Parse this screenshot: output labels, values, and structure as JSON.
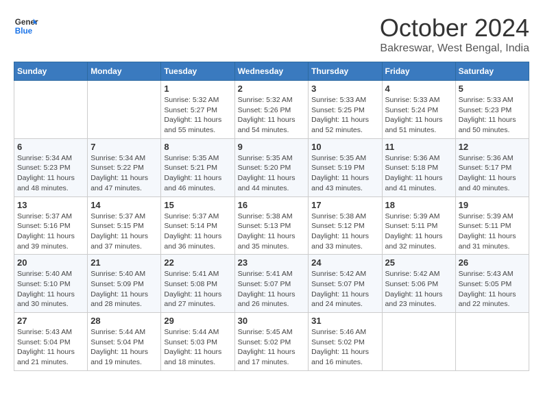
{
  "logo": {
    "line1": "General",
    "line2": "Blue"
  },
  "title": "October 2024",
  "location": "Bakreswar, West Bengal, India",
  "days_of_week": [
    "Sunday",
    "Monday",
    "Tuesday",
    "Wednesday",
    "Thursday",
    "Friday",
    "Saturday"
  ],
  "weeks": [
    [
      {
        "day": "",
        "sunrise": "",
        "sunset": "",
        "daylight": ""
      },
      {
        "day": "",
        "sunrise": "",
        "sunset": "",
        "daylight": ""
      },
      {
        "day": "1",
        "sunrise": "Sunrise: 5:32 AM",
        "sunset": "Sunset: 5:27 PM",
        "daylight": "Daylight: 11 hours and 55 minutes."
      },
      {
        "day": "2",
        "sunrise": "Sunrise: 5:32 AM",
        "sunset": "Sunset: 5:26 PM",
        "daylight": "Daylight: 11 hours and 54 minutes."
      },
      {
        "day": "3",
        "sunrise": "Sunrise: 5:33 AM",
        "sunset": "Sunset: 5:25 PM",
        "daylight": "Daylight: 11 hours and 52 minutes."
      },
      {
        "day": "4",
        "sunrise": "Sunrise: 5:33 AM",
        "sunset": "Sunset: 5:24 PM",
        "daylight": "Daylight: 11 hours and 51 minutes."
      },
      {
        "day": "5",
        "sunrise": "Sunrise: 5:33 AM",
        "sunset": "Sunset: 5:23 PM",
        "daylight": "Daylight: 11 hours and 50 minutes."
      }
    ],
    [
      {
        "day": "6",
        "sunrise": "Sunrise: 5:34 AM",
        "sunset": "Sunset: 5:23 PM",
        "daylight": "Daylight: 11 hours and 48 minutes."
      },
      {
        "day": "7",
        "sunrise": "Sunrise: 5:34 AM",
        "sunset": "Sunset: 5:22 PM",
        "daylight": "Daylight: 11 hours and 47 minutes."
      },
      {
        "day": "8",
        "sunrise": "Sunrise: 5:35 AM",
        "sunset": "Sunset: 5:21 PM",
        "daylight": "Daylight: 11 hours and 46 minutes."
      },
      {
        "day": "9",
        "sunrise": "Sunrise: 5:35 AM",
        "sunset": "Sunset: 5:20 PM",
        "daylight": "Daylight: 11 hours and 44 minutes."
      },
      {
        "day": "10",
        "sunrise": "Sunrise: 5:35 AM",
        "sunset": "Sunset: 5:19 PM",
        "daylight": "Daylight: 11 hours and 43 minutes."
      },
      {
        "day": "11",
        "sunrise": "Sunrise: 5:36 AM",
        "sunset": "Sunset: 5:18 PM",
        "daylight": "Daylight: 11 hours and 41 minutes."
      },
      {
        "day": "12",
        "sunrise": "Sunrise: 5:36 AM",
        "sunset": "Sunset: 5:17 PM",
        "daylight": "Daylight: 11 hours and 40 minutes."
      }
    ],
    [
      {
        "day": "13",
        "sunrise": "Sunrise: 5:37 AM",
        "sunset": "Sunset: 5:16 PM",
        "daylight": "Daylight: 11 hours and 39 minutes."
      },
      {
        "day": "14",
        "sunrise": "Sunrise: 5:37 AM",
        "sunset": "Sunset: 5:15 PM",
        "daylight": "Daylight: 11 hours and 37 minutes."
      },
      {
        "day": "15",
        "sunrise": "Sunrise: 5:37 AM",
        "sunset": "Sunset: 5:14 PM",
        "daylight": "Daylight: 11 hours and 36 minutes."
      },
      {
        "day": "16",
        "sunrise": "Sunrise: 5:38 AM",
        "sunset": "Sunset: 5:13 PM",
        "daylight": "Daylight: 11 hours and 35 minutes."
      },
      {
        "day": "17",
        "sunrise": "Sunrise: 5:38 AM",
        "sunset": "Sunset: 5:12 PM",
        "daylight": "Daylight: 11 hours and 33 minutes."
      },
      {
        "day": "18",
        "sunrise": "Sunrise: 5:39 AM",
        "sunset": "Sunset: 5:11 PM",
        "daylight": "Daylight: 11 hours and 32 minutes."
      },
      {
        "day": "19",
        "sunrise": "Sunrise: 5:39 AM",
        "sunset": "Sunset: 5:11 PM",
        "daylight": "Daylight: 11 hours and 31 minutes."
      }
    ],
    [
      {
        "day": "20",
        "sunrise": "Sunrise: 5:40 AM",
        "sunset": "Sunset: 5:10 PM",
        "daylight": "Daylight: 11 hours and 30 minutes."
      },
      {
        "day": "21",
        "sunrise": "Sunrise: 5:40 AM",
        "sunset": "Sunset: 5:09 PM",
        "daylight": "Daylight: 11 hours and 28 minutes."
      },
      {
        "day": "22",
        "sunrise": "Sunrise: 5:41 AM",
        "sunset": "Sunset: 5:08 PM",
        "daylight": "Daylight: 11 hours and 27 minutes."
      },
      {
        "day": "23",
        "sunrise": "Sunrise: 5:41 AM",
        "sunset": "Sunset: 5:07 PM",
        "daylight": "Daylight: 11 hours and 26 minutes."
      },
      {
        "day": "24",
        "sunrise": "Sunrise: 5:42 AM",
        "sunset": "Sunset: 5:07 PM",
        "daylight": "Daylight: 11 hours and 24 minutes."
      },
      {
        "day": "25",
        "sunrise": "Sunrise: 5:42 AM",
        "sunset": "Sunset: 5:06 PM",
        "daylight": "Daylight: 11 hours and 23 minutes."
      },
      {
        "day": "26",
        "sunrise": "Sunrise: 5:43 AM",
        "sunset": "Sunset: 5:05 PM",
        "daylight": "Daylight: 11 hours and 22 minutes."
      }
    ],
    [
      {
        "day": "27",
        "sunrise": "Sunrise: 5:43 AM",
        "sunset": "Sunset: 5:04 PM",
        "daylight": "Daylight: 11 hours and 21 minutes."
      },
      {
        "day": "28",
        "sunrise": "Sunrise: 5:44 AM",
        "sunset": "Sunset: 5:04 PM",
        "daylight": "Daylight: 11 hours and 19 minutes."
      },
      {
        "day": "29",
        "sunrise": "Sunrise: 5:44 AM",
        "sunset": "Sunset: 5:03 PM",
        "daylight": "Daylight: 11 hours and 18 minutes."
      },
      {
        "day": "30",
        "sunrise": "Sunrise: 5:45 AM",
        "sunset": "Sunset: 5:02 PM",
        "daylight": "Daylight: 11 hours and 17 minutes."
      },
      {
        "day": "31",
        "sunrise": "Sunrise: 5:46 AM",
        "sunset": "Sunset: 5:02 PM",
        "daylight": "Daylight: 11 hours and 16 minutes."
      },
      {
        "day": "",
        "sunrise": "",
        "sunset": "",
        "daylight": ""
      },
      {
        "day": "",
        "sunrise": "",
        "sunset": "",
        "daylight": ""
      }
    ]
  ]
}
